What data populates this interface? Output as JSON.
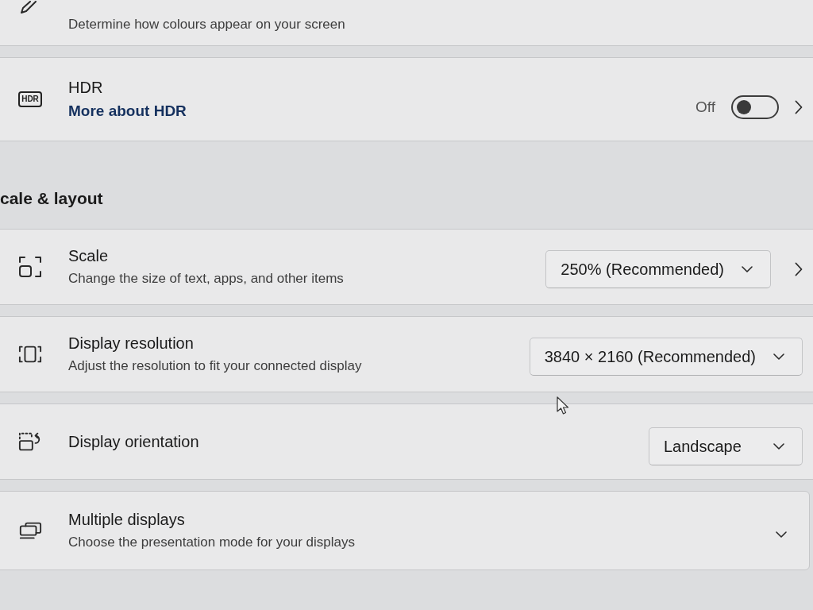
{
  "sections": [
    {
      "rows": [
        {
          "kind": "info",
          "description": "Determine how colours appear on your screen",
          "arrow": false
        },
        {
          "kind": "toggle",
          "badge": "HDR",
          "title": "HDR",
          "link": "More about HDR",
          "state_label": "Off",
          "on": false,
          "arrow": true
        }
      ]
    },
    {
      "title": "cale & layout",
      "rows": [
        {
          "kind": "dropdown",
          "title": "Scale",
          "description": "Change the size of text, apps, and other items",
          "value": "250% (Recommended)",
          "arrow": true
        },
        {
          "kind": "dropdown",
          "title": "Display resolution",
          "description": "Adjust the resolution to fit your connected display",
          "value": "3840 × 2160 (Recommended)",
          "arrow": false
        },
        {
          "kind": "dropdown",
          "title": "Display orientation",
          "value": "Landscape",
          "arrow": false
        },
        {
          "kind": "expander",
          "title": "Multiple displays",
          "description": "Choose the presentation mode for your displays",
          "expanded": false,
          "arrow": false
        }
      ]
    }
  ]
}
